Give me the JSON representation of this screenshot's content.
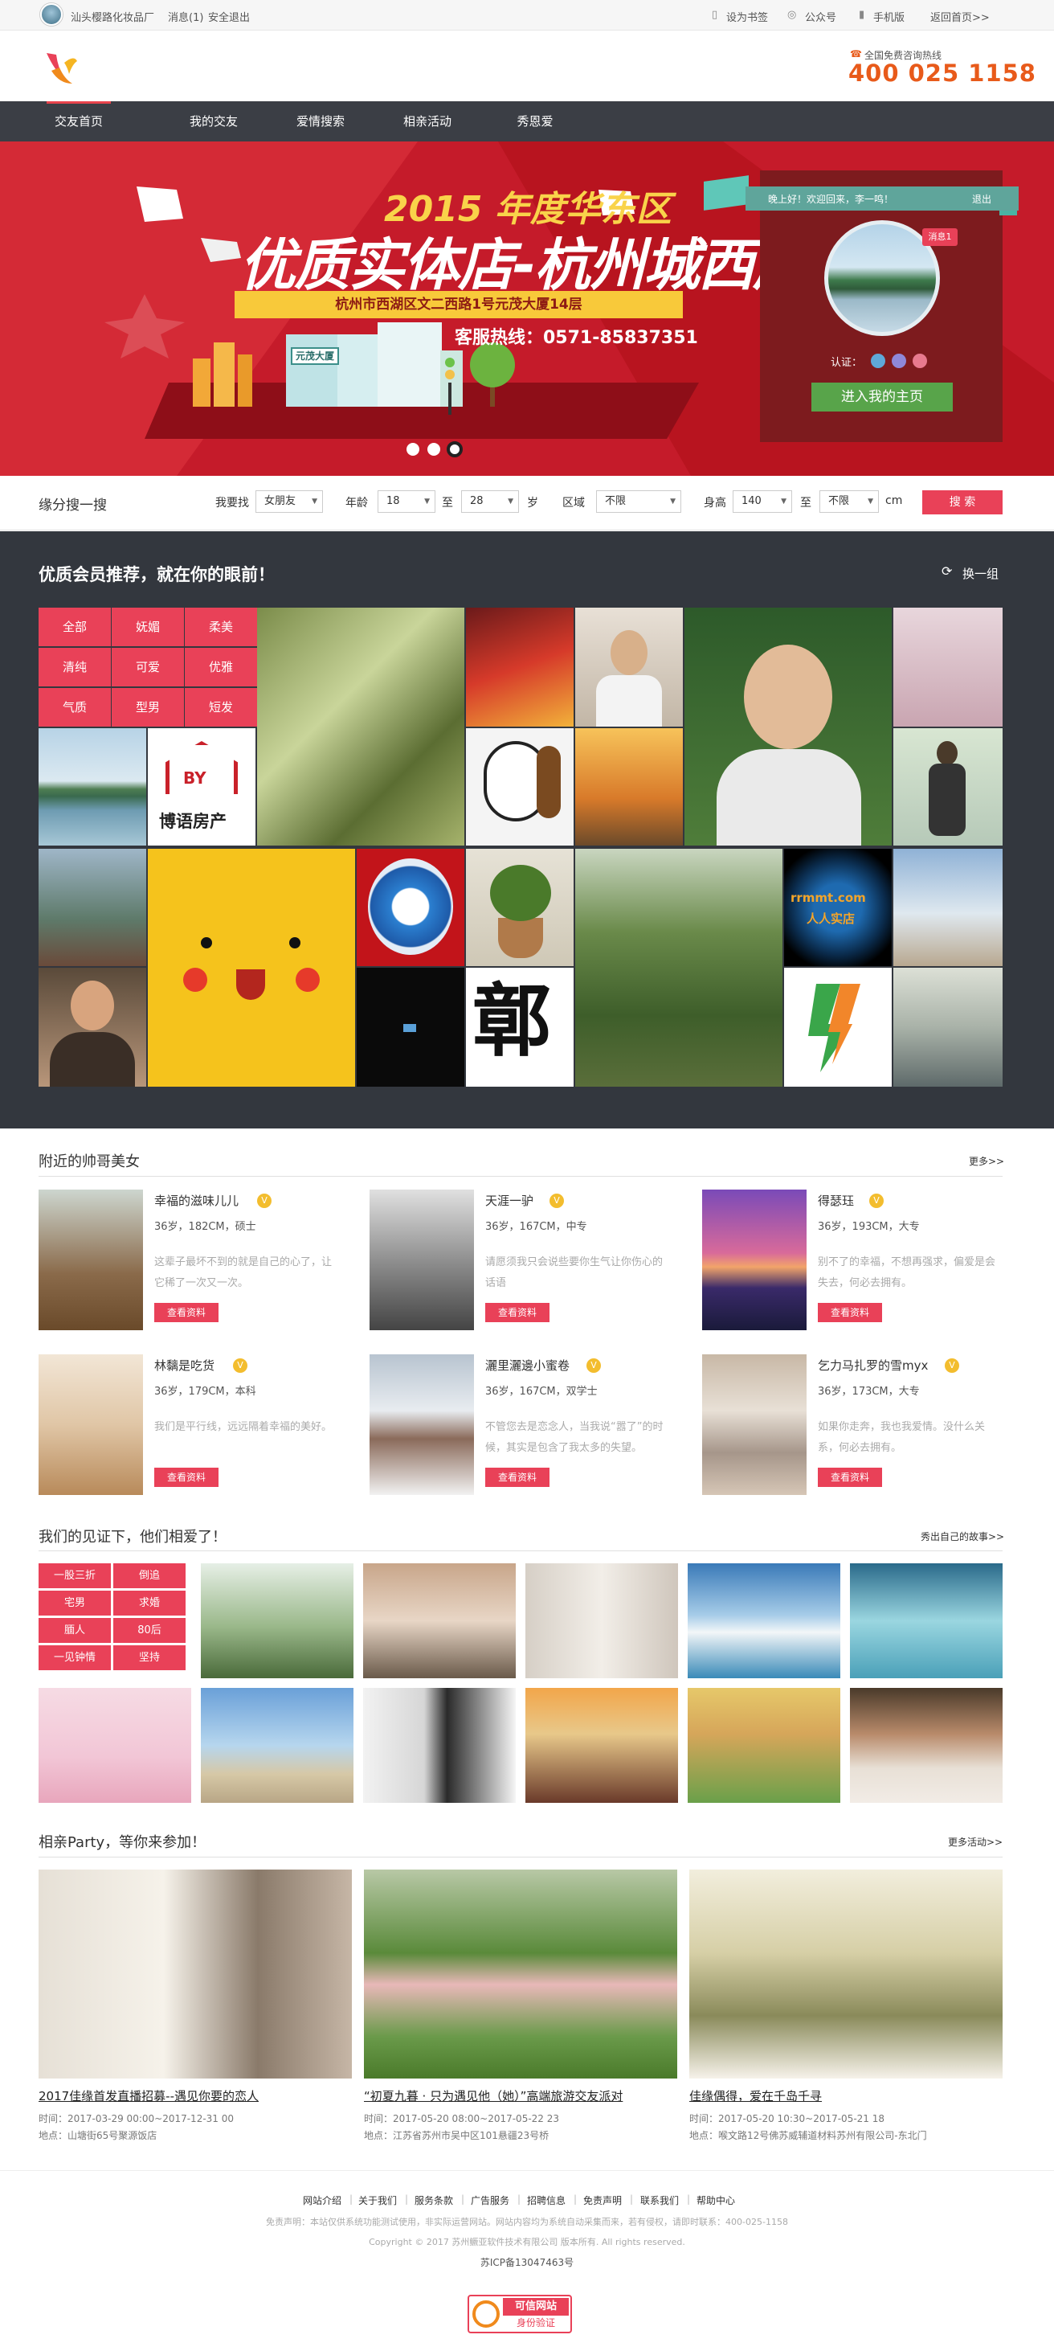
{
  "topbar": {
    "site_name": "汕头樱路化妆品厂",
    "messages": "消息(1)",
    "logout": "安全退出",
    "bookmark": "设为书签",
    "official": "公众号",
    "mobile": "手机版",
    "home": "返回首页>>"
  },
  "header": {
    "hotline_label": "全国免费咨询热线",
    "hotline_number": "400 025 1158"
  },
  "nav": {
    "items": [
      "交友首页",
      "我的交友",
      "爱情搜索",
      "相亲活动",
      "秀恩爱"
    ]
  },
  "banner": {
    "year_title": "2015 年度华东区",
    "main_title": "优质实体店-杭州城西店",
    "address": "杭州市西湖区文二西路1号元茂大厦14层",
    "hotline": "客服热线：0571-85837351",
    "building_label": "元茂大厦",
    "welcome": "晚上好！欢迎回来，李一鸣！",
    "logout": "退出",
    "msg_badge": "消息1",
    "verify_label": "认证：",
    "home_button": "进入我的主页"
  },
  "search": {
    "title": "缘分搜一搜",
    "find_label": "我要找",
    "find_value": "女朋友",
    "age_label": "年龄",
    "age_from": "18",
    "to1": "至",
    "age_to": "28",
    "age_unit": "岁",
    "area_label": "区域",
    "area_value": "不限",
    "height_label": "身高",
    "height_from": "140",
    "to2": "至",
    "height_to": "不限",
    "height_unit": "cm",
    "button": "搜 索"
  },
  "recommend": {
    "title": "优质会员推荐，就在你的眼前！",
    "refresh": "换一组",
    "tags": [
      "全部",
      "妩媚",
      "柔美",
      "清纯",
      "可爱",
      "优雅",
      "气质",
      "型男",
      "短发"
    ],
    "logo_tile": "博语房产",
    "logo_badge": "BY",
    "globe_text": "rrmmt.com",
    "globe_sub": "人人实店"
  },
  "nearby": {
    "title": "附近的帅哥美女",
    "more": "更多>>",
    "people": [
      {
        "name": "幸福的滋味儿儿",
        "badge": "V",
        "info": "36岁，182CM，硕士",
        "desc": "这辈子最坏不到的就是自己的心了，让它稀了一次又一次。",
        "btn": "查看资料"
      },
      {
        "name": "天涯一驴",
        "badge": "V",
        "info": "36岁，167CM，中专",
        "desc": "请愿须我只会说些要你生气让你伤心的话语",
        "btn": "查看资料"
      },
      {
        "name": "得瑟珏",
        "badge": "V",
        "info": "36岁，193CM，大专",
        "desc": "别不了的幸福，不想再强求，偏爱是会失去，何必去拥有。",
        "btn": "查看资料"
      },
      {
        "name": "林黐是吃货",
        "badge": "V",
        "info": "36岁，179CM，本科",
        "desc": "我们是平行线，远远隔着幸福的美好。",
        "btn": "查看资料"
      },
      {
        "name": "灑里灑邊小蜜卷",
        "badge": "V",
        "info": "36岁，167CM，双学士",
        "desc": "不管您去是恋念人，当我说“嚣了”的时候，其实是包含了我太多的失望。",
        "btn": "查看资料"
      },
      {
        "name": "乞力马扎罗的雪myx",
        "badge": "V",
        "info": "36岁，173CM，大专",
        "desc": "如果你走奔，我也我爱情。没什么关系，何必去拥有。",
        "btn": "查看资料"
      }
    ]
  },
  "stories": {
    "title": "我们的见证下，他们相爱了！",
    "more": "秀出自己的故事>>",
    "tags": [
      "一股三折",
      "倒追",
      "宅男",
      "求婚",
      "腼人",
      "80后",
      "一见钟情",
      "坚持"
    ]
  },
  "party": {
    "title": "相亲Party，等你来参加！",
    "more": "更多活动>>",
    "events": [
      {
        "title": "2017佳缘首发直播招募--遇见你要的恋人",
        "time": "时间：2017-03-29 00:00~2017-12-31 00",
        "place": "地点：山塘街65号聚源饭店"
      },
      {
        "title": "“初夏九暮 · 只为遇见他（她）”高端旅游交友派对",
        "time": "时间：2017-05-20 08:00~2017-05-22 23",
        "place": "地点：江苏省苏州市吴中区101悬疆23号桥"
      },
      {
        "title": "佳缘偶得，爱在千岛千寻",
        "time": "时间：2017-05-20 10:30~2017-05-21 18",
        "place": "地点：喉文路12号佛苏威辅道材料苏州有限公司-东北门"
      }
    ]
  },
  "footer": {
    "links": [
      "网站介绍",
      "关于我们",
      "服务条款",
      "广告服务",
      "招聘信息",
      "免责声明",
      "联系我们",
      "帮助中心"
    ],
    "disclaimer": "免责声明：本站仅供系统功能测试使用，非实际运营网站。网站内容均为系统自动采集而来，若有侵权，请即时联系：400-025-1158",
    "copyright": "Copyright © 2017 苏州鳜亚软件技术有限公司 版本所有. All rights reserved.",
    "icp": "苏ICP备13047463号",
    "badge_line1": "可信网站",
    "badge_line2": "身份验证"
  },
  "colors": {
    "accent": "#e94158",
    "nav_bg": "#3b3e45",
    "rec_bg": "#33373e",
    "hotline": "#e85a1a",
    "banner": "#c51b2a",
    "green": "#58a44a"
  }
}
